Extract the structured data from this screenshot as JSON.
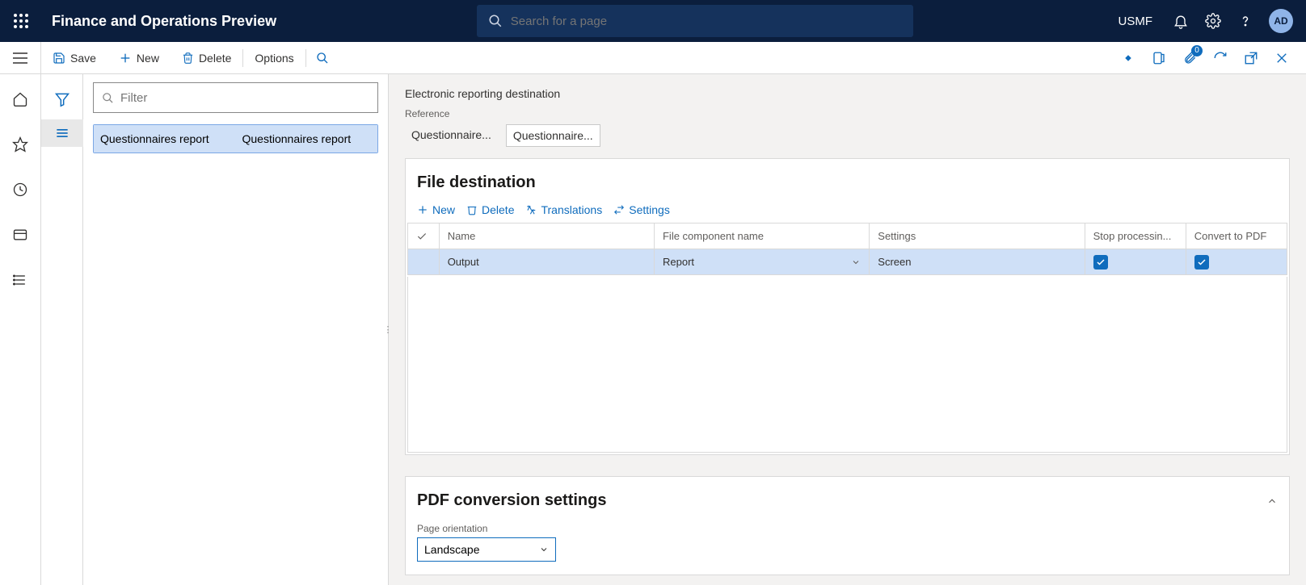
{
  "top": {
    "title": "Finance and Operations Preview",
    "search_placeholder": "Search for a page",
    "company": "USMF",
    "avatar": "AD",
    "badge": "0"
  },
  "action": {
    "save": "Save",
    "new": "New",
    "delete": "Delete",
    "options": "Options"
  },
  "filter_placeholder": "Filter",
  "list": {
    "col1": "Questionnaires report",
    "col2": "Questionnaires report"
  },
  "page": {
    "title": "Electronic reporting destination",
    "ref_label": "Reference",
    "ref1": "Questionnaire...",
    "ref2": "Questionnaire..."
  },
  "card1": {
    "title": "File destination",
    "tb_new": "New",
    "tb_delete": "Delete",
    "tb_translations": "Translations",
    "tb_settings": "Settings",
    "headers": {
      "name": "Name",
      "file_component": "File component name",
      "settings": "Settings",
      "stop": "Stop processin...",
      "convert": "Convert to PDF"
    },
    "row": {
      "name": "Output",
      "file_component": "Report",
      "settings": "Screen"
    }
  },
  "card2": {
    "title": "PDF conversion settings",
    "orientation_label": "Page orientation",
    "orientation_value": "Landscape"
  }
}
